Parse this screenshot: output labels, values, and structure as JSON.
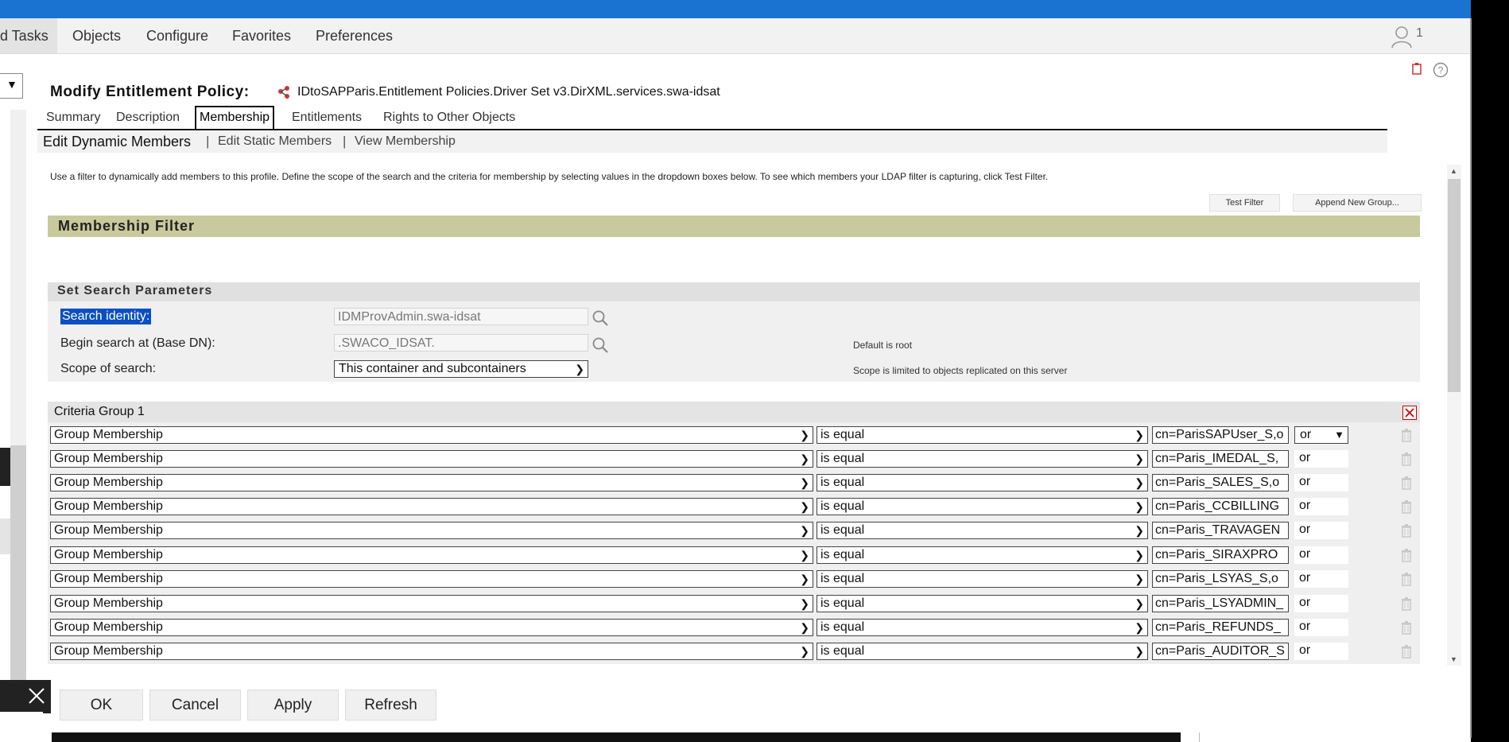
{
  "menubar": {
    "items": [
      "d Tasks",
      "Objects",
      "Configure",
      "Favorites",
      "Preferences"
    ],
    "user_count": "1"
  },
  "header": {
    "title": "Modify Entitlement Policy:",
    "object_name": "IDtoSAPParis.Entitlement Policies.Driver Set v3.DirXML.services.swa-idsat"
  },
  "tabs": [
    "Summary",
    "Description",
    "Membership",
    "Entitlements",
    "Rights to Other Objects"
  ],
  "active_tab": "Membership",
  "subtabs": [
    "Edit Dynamic Members",
    "Edit Static Members",
    "View Membership"
  ],
  "intro_text": "Use a filter to dynamically add members to this profile. Define the scope of the search and the criteria for membership by selecting values in the dropdown boxes below. To see which members your LDAP filter is capturing, click Test Filter.",
  "buttons": {
    "test_filter": "Test Filter",
    "append_group": "Append New Group..."
  },
  "membership_filter_title": "Membership Filter",
  "search_params": {
    "title": "Set Search Parameters",
    "search_identity_label": "Search identity:",
    "search_identity_value": "IDMProvAdmin.swa-idsat",
    "base_dn_label": "Begin search at (Base DN):",
    "base_dn_value": ".SWACO_IDSAT.",
    "base_dn_note": "Default is root",
    "scope_label": "Scope of search:",
    "scope_value": "This container and subcontainers",
    "scope_note": "Scope is limited to objects replicated on this server"
  },
  "criteria_group": {
    "title": "Criteria Group 1",
    "rows": [
      {
        "attribute": "Group Membership",
        "operator": "is equal",
        "value": "cn=ParisSAPUser_S,o",
        "logic": "or"
      },
      {
        "attribute": "Group Membership",
        "operator": "is equal",
        "value": "cn=Paris_IMEDAL_S,",
        "logic": "or"
      },
      {
        "attribute": "Group Membership",
        "operator": "is equal",
        "value": "cn=Paris_SALES_S,o",
        "logic": "or"
      },
      {
        "attribute": "Group Membership",
        "operator": "is equal",
        "value": "cn=Paris_CCBILLING",
        "logic": "or"
      },
      {
        "attribute": "Group Membership",
        "operator": "is equal",
        "value": "cn=Paris_TRAVAGEN",
        "logic": "or"
      },
      {
        "attribute": "Group Membership",
        "operator": "is equal",
        "value": "cn=Paris_SIRAXPRO",
        "logic": "or"
      },
      {
        "attribute": "Group Membership",
        "operator": "is equal",
        "value": "cn=Paris_LSYAS_S,o",
        "logic": "or"
      },
      {
        "attribute": "Group Membership",
        "operator": "is equal",
        "value": "cn=Paris_LSYADMIN_",
        "logic": "or"
      },
      {
        "attribute": "Group Membership",
        "operator": "is equal",
        "value": "cn=Paris_REFUNDS_",
        "logic": "or"
      },
      {
        "attribute": "Group Membership",
        "operator": "is equal",
        "value": "cn=Paris_AUDITOR_S",
        "logic": "or"
      }
    ]
  },
  "footer": {
    "ok": "OK",
    "cancel": "Cancel",
    "apply": "Apply",
    "refresh": "Refresh"
  },
  "colors": {
    "topbar": "#1a73d1",
    "filter_bar": "#c8c99c",
    "selection": "#0a4fc4"
  },
  "icons": [
    "user-icon",
    "help-icon",
    "policy-object-icon",
    "search-icon",
    "close-icon",
    "trash-icon",
    "chevron-down-icon"
  ]
}
